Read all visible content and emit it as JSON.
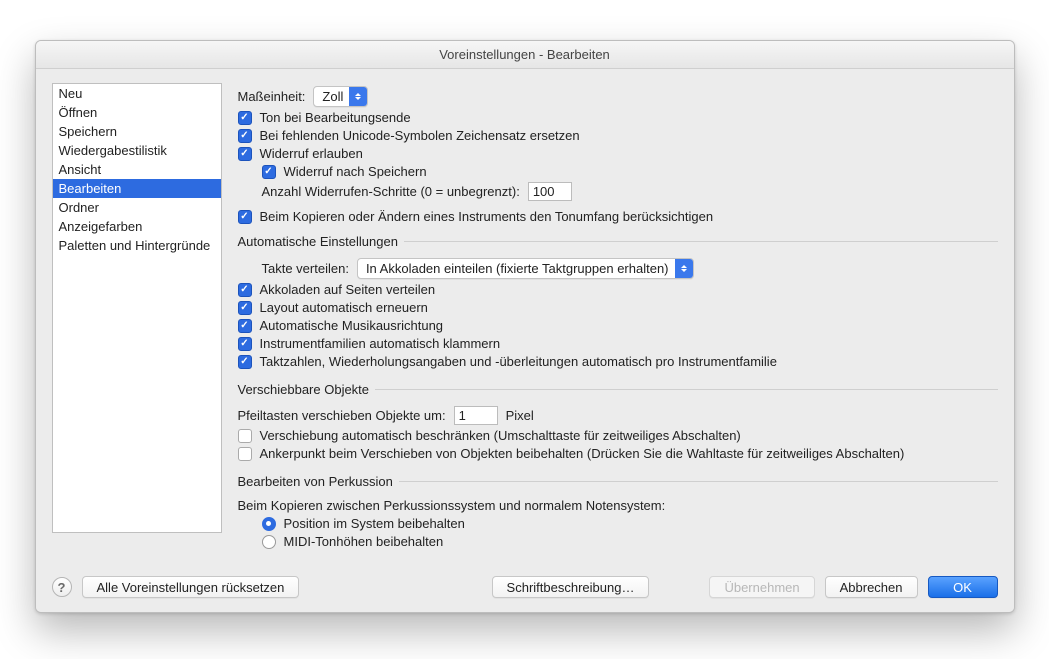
{
  "window_title": "Voreinstellungen - Bearbeiten",
  "sidebar": {
    "items": [
      {
        "label": "Neu"
      },
      {
        "label": "Öffnen"
      },
      {
        "label": "Speichern"
      },
      {
        "label": "Wiedergabestilistik"
      },
      {
        "label": "Ansicht"
      },
      {
        "label": "Bearbeiten"
      },
      {
        "label": "Ordner"
      },
      {
        "label": "Anzeigefarben"
      },
      {
        "label": "Paletten und Hintergründe"
      }
    ],
    "selected_index": 5
  },
  "unit": {
    "label": "Maßeinheit:",
    "value": "Zoll"
  },
  "checks": {
    "sound_end": "Ton bei Bearbeitungsende",
    "unicode_fallback": "Bei fehlenden Unicode-Symbolen Zeichensatz ersetzen",
    "undo_allow": "Widerruf erlauben",
    "undo_after_save": "Widerruf nach Speichern",
    "undo_steps_label": "Anzahl Widerrufen-Schritte (0 = unbegrenzt):",
    "undo_steps_value": "100",
    "copy_instrument_range": "Beim Kopieren oder Ändern eines Instruments den Tonumfang berücksichtigen"
  },
  "auto": {
    "legend": "Automatische Einstellungen",
    "takte_label": "Takte verteilen:",
    "takte_value": "In Akkoladen einteilen (fixierte Taktgruppen erhalten)",
    "akkoladen": "Akkoladen auf Seiten verteilen",
    "layout": "Layout automatisch erneuern",
    "music_align": "Automatische Musikausrichtung",
    "instrument_brackets": "Instrumentfamilien automatisch klammern",
    "bar_numbers": "Taktzahlen, Wiederholungsangaben und -überleitungen automatisch pro Instrumentfamilie"
  },
  "move": {
    "legend": "Verschiebbare Objekte",
    "arrow_label": "Pfeiltasten verschieben Objekte um:",
    "arrow_value": "1",
    "arrow_unit": "Pixel",
    "restrict": "Verschiebung automatisch beschränken (Umschalttaste für zeitweiliges Abschalten)",
    "anchor": "Ankerpunkt beim Verschieben von Objekten beibehalten (Drücken Sie die Wahltaste für zeitweiliges Abschalten)"
  },
  "perc": {
    "legend": "Bearbeiten von Perkussion",
    "intro": "Beim Kopieren zwischen Perkussionssystem und normalem Notensystem:",
    "opt1": "Position im System beibehalten",
    "opt2": "MIDI-Tonhöhen beibehalten"
  },
  "buttons": {
    "reset_all": "Alle Voreinstellungen rücksetzen",
    "font_desc": "Schriftbeschreibung…",
    "apply": "Übernehmen",
    "cancel": "Abbrechen",
    "ok": "OK"
  }
}
